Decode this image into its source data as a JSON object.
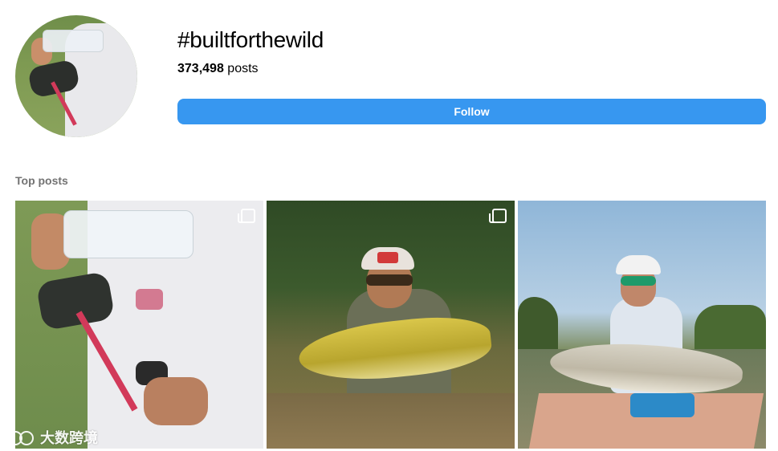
{
  "header": {
    "hashtag": "#builtforthewild",
    "post_count": "373,498",
    "post_count_suffix": " posts",
    "follow_label": "Follow"
  },
  "sections": {
    "top_posts_title": "Top posts"
  },
  "posts": [
    {
      "multiple_media": true
    },
    {
      "multiple_media": true
    },
    {
      "multiple_media": false
    }
  ],
  "watermark": {
    "text": "大数跨境"
  },
  "colors": {
    "accent": "#3797f0",
    "muted_text": "#737373"
  }
}
